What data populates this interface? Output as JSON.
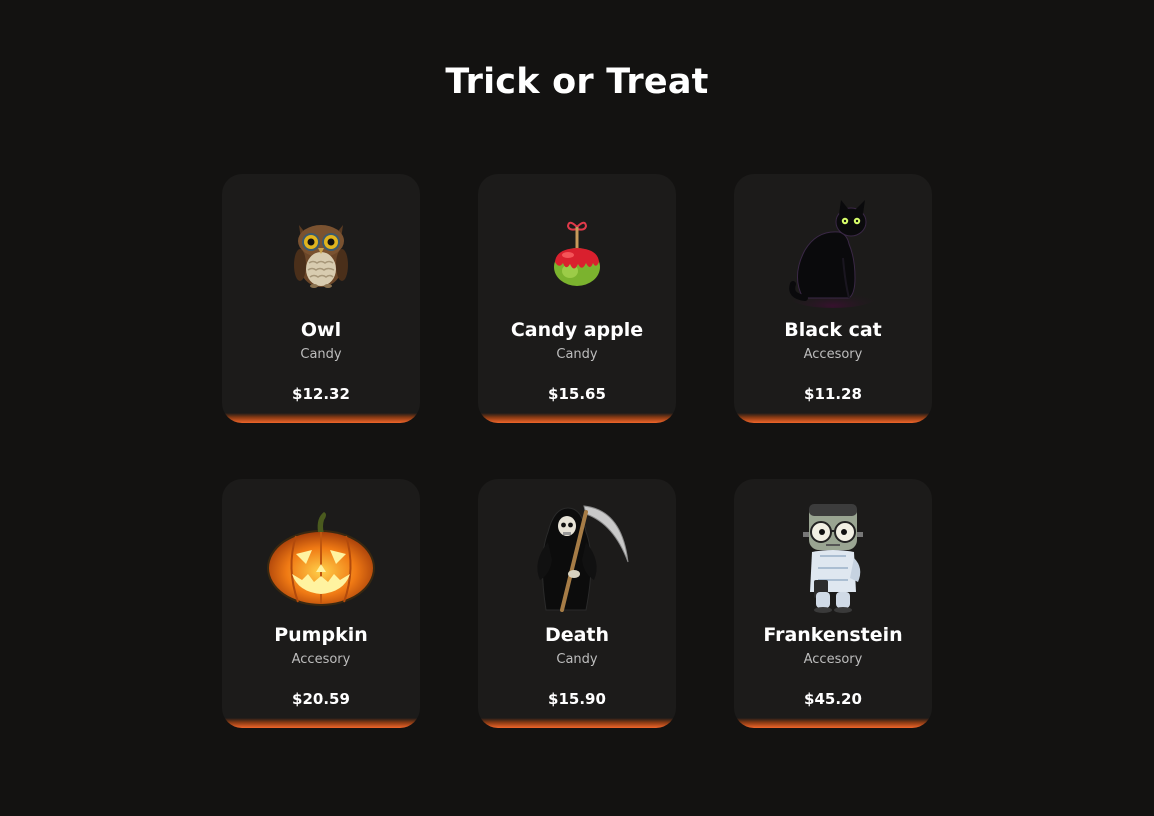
{
  "page": {
    "title": "Trick or Treat"
  },
  "colors": {
    "background": "#131211",
    "card": "#1c1b1a",
    "accent": "#f0652a"
  },
  "products": [
    {
      "name": "Owl",
      "category": "Candy",
      "price": "$12.32",
      "icon": "owl-icon"
    },
    {
      "name": "Candy apple",
      "category": "Candy",
      "price": "$15.65",
      "icon": "candy-apple-icon"
    },
    {
      "name": "Black cat",
      "category": "Accesory",
      "price": "$11.28",
      "icon": "black-cat-icon"
    },
    {
      "name": "Pumpkin",
      "category": "Accesory",
      "price": "$20.59",
      "icon": "pumpkin-icon"
    },
    {
      "name": "Death",
      "category": "Candy",
      "price": "$15.90",
      "icon": "grim-reaper-icon"
    },
    {
      "name": "Frankenstein",
      "category": "Accesory",
      "price": "$45.20",
      "icon": "frankenstein-icon"
    }
  ]
}
